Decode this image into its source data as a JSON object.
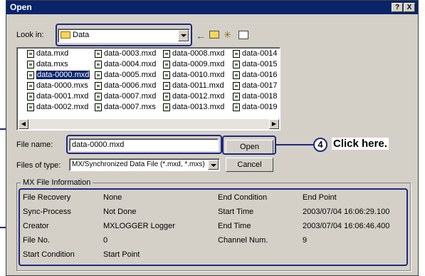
{
  "dialog": {
    "title": "Open",
    "help_label": "?",
    "close_label": "X"
  },
  "look_in": {
    "label": "Look in:",
    "value": "Data"
  },
  "files": [
    [
      "data.mxd",
      "data.mxs",
      "data-0000.mxd",
      "data-0000.mxs",
      "data-0001.mxd",
      "data-0002.mxd"
    ],
    [
      "data-0003.mxd",
      "data-0004.mxd",
      "data-0005.mxd",
      "data-0006.mxd",
      "data-0007.mxd",
      "data-0007.mxs"
    ],
    [
      "data-0008.mxd",
      "data-0009.mxd",
      "data-0010.mxd",
      "data-0011.mxd",
      "data-0012.mxd",
      "data-0013.mxd"
    ],
    [
      "data-0014",
      "data-0015",
      "data-0016",
      "data-0017",
      "data-0018",
      "data-0019"
    ]
  ],
  "file_name": {
    "label": "File name:",
    "value": "data-0000.mxd"
  },
  "file_type": {
    "label": "Files of type:",
    "value": "MX/Synchronized Data File (*.mxd, *.mxs)"
  },
  "buttons": {
    "open": "Open",
    "cancel": "Cancel"
  },
  "annotation": {
    "number": "4",
    "text": "Click here."
  },
  "info": {
    "group_label": "MX File Information",
    "rows": [
      {
        "k1": "File Recovery",
        "v1": "None",
        "k2": "End Condition",
        "v2": "End Point"
      },
      {
        "k1": "Sync-Process",
        "v1": "Not Done",
        "k2": "Start Time",
        "v2": "2003/07/04 16:06:29.100"
      },
      {
        "k1": "Creator",
        "v1": "MXLOGGER Logger",
        "k2": "End Time",
        "v2": "2003/07/04 16:06:46.400"
      },
      {
        "k1": "File No.",
        "v1": "0",
        "k2": "Channel Num.",
        "v2": "9"
      },
      {
        "k1": "Start Condition",
        "v1": "Start Point",
        "k2": "",
        "v2": ""
      }
    ]
  },
  "colors": {
    "title_bar": "#0a246a",
    "callout": "#1e2880",
    "face": "#d4d0c8"
  }
}
